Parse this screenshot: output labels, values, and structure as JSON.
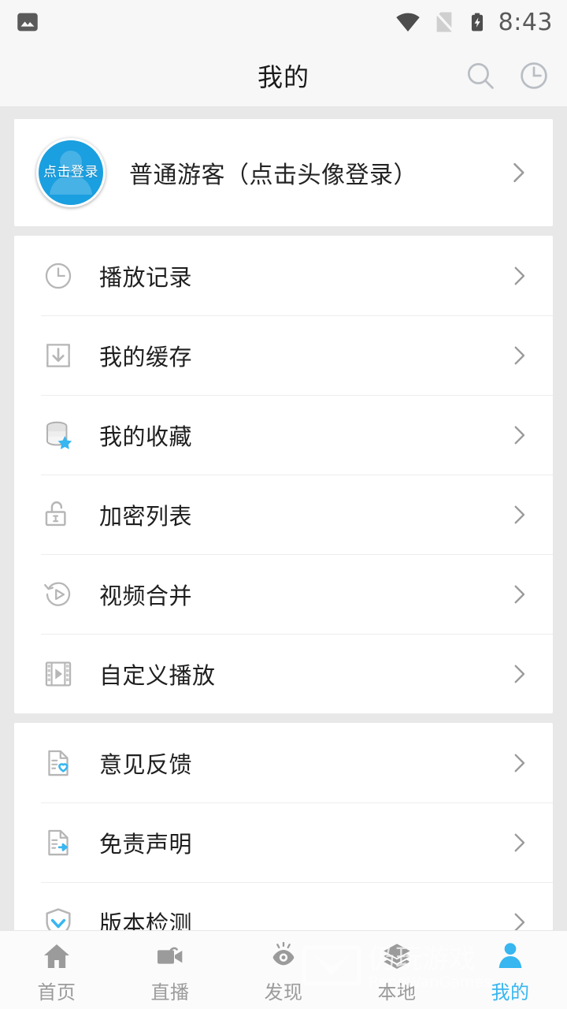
{
  "statusbar": {
    "left_icons": [
      "image-notification-icon"
    ],
    "wifi_icon": "wifi-icon",
    "sim_icon": "no-sim-icon",
    "battery_icon": "battery-charging-icon",
    "time": "8:43"
  },
  "header": {
    "title": "我的",
    "actions": [
      {
        "name": "search-icon",
        "label": "搜索"
      },
      {
        "name": "history-clock-icon",
        "label": "历史"
      }
    ]
  },
  "profile": {
    "avatar_label": "点击登录",
    "name": "普通游客（点击头像登录）",
    "chevron": "chevron-right-icon"
  },
  "groups": [
    {
      "id": "group-main",
      "items": [
        {
          "icon": "clock-icon",
          "label": "播放记录"
        },
        {
          "icon": "download-box-icon",
          "label": "我的缓存"
        },
        {
          "icon": "database-star-icon",
          "label": "我的收藏"
        },
        {
          "icon": "unlock-icon",
          "label": "加密列表"
        },
        {
          "icon": "replay-play-icon",
          "label": "视频合并"
        },
        {
          "icon": "film-play-icon",
          "label": "自定义播放"
        }
      ]
    },
    {
      "id": "group-about",
      "items": [
        {
          "icon": "document-heart-icon",
          "label": "意见反馈"
        },
        {
          "icon": "document-arrow-icon",
          "label": "免责声明"
        },
        {
          "icon": "shield-check-icon",
          "label": "版本检测"
        }
      ]
    }
  ],
  "tabbar": {
    "active_index": 4,
    "items": [
      {
        "icon": "home-icon",
        "label": "首页"
      },
      {
        "icon": "camera-icon",
        "label": "直播"
      },
      {
        "icon": "eye-icon",
        "label": "发现"
      },
      {
        "icon": "layers-icon",
        "label": "本地"
      },
      {
        "icon": "person-icon",
        "label": "我的"
      }
    ]
  },
  "watermark": {
    "title": "仍玩游戏",
    "subtitle": "RengWanGames"
  },
  "colors": {
    "accent": "#37b6f0",
    "avatar_blue": "#1a9fe0",
    "page_bg": "#e8e8e8",
    "card_bg": "#ffffff",
    "icon_gray": "#b0b0b0",
    "text_primary": "#1f1f1f",
    "text_muted": "#9b9b9b"
  }
}
